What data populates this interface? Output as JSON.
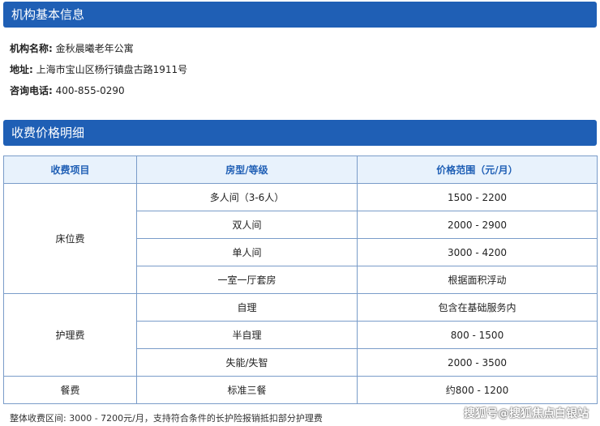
{
  "info_section": {
    "title": "机构基本信息",
    "name_label": "机构名称:",
    "name_value": "金秋晨曦老年公寓",
    "address_label": "地址:",
    "address_value": "上海市宝山区杨行镇盘古路1911号",
    "phone_label": "咨询电话:",
    "phone_value": "400-855-0290"
  },
  "price_section": {
    "title": "收费价格明细",
    "table": {
      "headers": [
        "收费项目",
        "房型/等级",
        "价格范围（元/月）"
      ],
      "groups": [
        {
          "item": "床位费",
          "rows": [
            {
              "type": "多人间（3-6人）",
              "price": "1500 - 2200"
            },
            {
              "type": "双人间",
              "price": "2000 - 2900"
            },
            {
              "type": "单人间",
              "price": "3000 - 4200"
            },
            {
              "type": "一室一厅套房",
              "price": "根据面积浮动"
            }
          ]
        },
        {
          "item": "护理费",
          "rows": [
            {
              "type": "自理",
              "price": "包含在基础服务内"
            },
            {
              "type": "半自理",
              "price": "800 - 1500"
            },
            {
              "type": "失能/失智",
              "price": "2000 - 3500"
            }
          ]
        },
        {
          "item": "餐费",
          "rows": [
            {
              "type": "标准三餐",
              "price": "约800 - 1200"
            }
          ]
        }
      ]
    }
  },
  "footnote": {
    "label": "整体收费区间:",
    "text": "3000 - 7200元/月，支持符合条件的长护险报销抵扣部分护理费"
  },
  "watermark": "搜狐号@搜狐焦点白银站"
}
